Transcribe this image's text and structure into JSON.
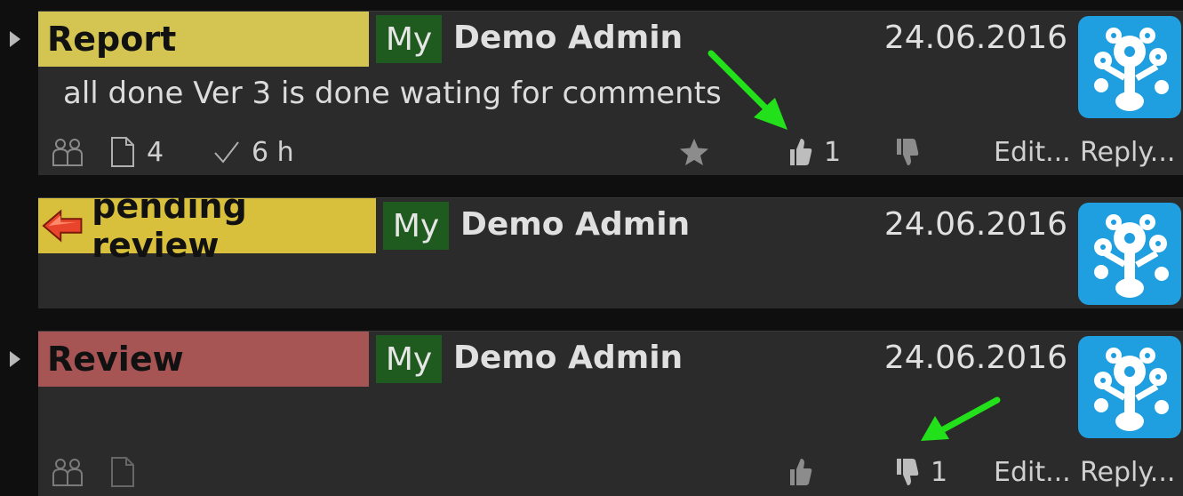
{
  "messages": [
    {
      "status": "Report",
      "status_color": "#d4c452",
      "tag": "My",
      "author": "Demo Admin",
      "date": "24.06.2016",
      "text": "all done Ver 3 is done wating for comments",
      "footer": {
        "attachments": "4",
        "time": "6 h",
        "likes": "1",
        "edit_label": "Edit...",
        "reply_label": "Reply..."
      }
    },
    {
      "status": "pending review",
      "status_color": "#d8bf3c",
      "tag": "My",
      "author": "Demo Admin",
      "date": "24.06.2016"
    },
    {
      "status": "Review",
      "status_color": "#a65454",
      "tag": "My",
      "author": "Demo Admin",
      "date": "24.06.2016",
      "footer": {
        "dislikes": "1",
        "edit_label": "Edit...",
        "reply_label": "Reply..."
      }
    }
  ],
  "colors": {
    "background": "#0f0f0f",
    "row": "#2b2b2b",
    "tag": "#1f5a1f",
    "avatar": "#1f9ee0",
    "annotation_arrow": "#22e01a"
  },
  "icons": [
    "expand-arrow-icon",
    "people-icon",
    "document-icon",
    "checkmark-icon",
    "star-icon",
    "thumbs-up-icon",
    "thumbs-down-icon",
    "left-arrow-icon",
    "avatar-logo-icon"
  ]
}
